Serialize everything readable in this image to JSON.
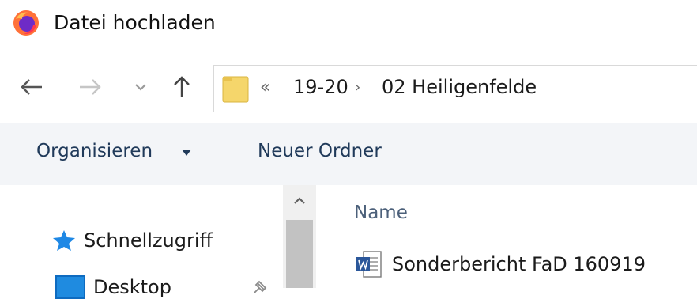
{
  "window": {
    "title": "Datei hochladen",
    "app_icon": "firefox-icon"
  },
  "navigation": {
    "back_icon": "arrow-left-icon",
    "forward_icon": "arrow-right-icon",
    "recent_icon": "chevron-down-icon",
    "up_icon": "arrow-up-icon"
  },
  "address_bar": {
    "folder_icon": "folder-icon",
    "overflow": "«",
    "breadcrumbs": [
      "19-20",
      "02 Heiligenfelde"
    ],
    "separator": "›"
  },
  "command_bar": {
    "organize_label": "Organisieren",
    "new_folder_label": "Neuer Ordner"
  },
  "nav_pane": {
    "items": [
      {
        "label": "Schnellzugriff",
        "icon": "star-icon"
      },
      {
        "label": "Desktop",
        "icon": "desktop-icon"
      }
    ]
  },
  "file_list": {
    "columns": [
      "Name"
    ],
    "files": [
      {
        "name": "Sonderbericht FaD 160919",
        "icon": "word-document-icon"
      }
    ]
  },
  "colors": {
    "command_bar_bg": "#f3f5f8",
    "command_text": "#203a5a",
    "folder": "#f5d66b",
    "word_blue": "#2b579a",
    "star_blue": "#1e88e5"
  }
}
